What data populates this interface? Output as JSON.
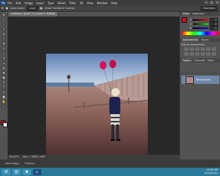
{
  "app": {
    "logo": "Ps"
  },
  "menu": {
    "items": [
      "File",
      "Edit",
      "Image",
      "Layer",
      "Type",
      "Select",
      "Filter",
      "3D",
      "View",
      "Window",
      "Help"
    ]
  },
  "window_controls": [
    "–",
    "□",
    "×"
  ],
  "options": {
    "auto_select": "Auto-Select:",
    "layer": "Layer",
    "transform": "Show Transform Controls",
    "workspace": "Essentials"
  },
  "document": {
    "tab_label": "Untitled-1 @ 66.7% (Layer 0, RGB/8)"
  },
  "statusbar": {
    "zoom": "66.67%",
    "doc_size": "Doc: 1.43M/1.43M"
  },
  "bottom_tabs": [
    "Mini Bridge",
    "Timeline"
  ],
  "panels": {
    "color_tabs": [
      "Color",
      "Swatches"
    ],
    "rgb": [
      {
        "label": "R",
        "value": "0"
      },
      {
        "label": "G",
        "value": "0"
      },
      {
        "label": "B",
        "value": "0"
      }
    ],
    "adjustments_tabs": [
      "Adjustments",
      "Styles"
    ],
    "adjustments_title": "Add an adjustment",
    "layers_tabs": [
      "Layers",
      "Channels",
      "Paths"
    ],
    "layer_name": "Background"
  },
  "taskbar": {
    "time": "10:26 AM",
    "date": "27/03/2014"
  },
  "colors": {
    "foreground": "#c8101a",
    "background": "#ffffff",
    "accent": "#2b7a9b"
  }
}
